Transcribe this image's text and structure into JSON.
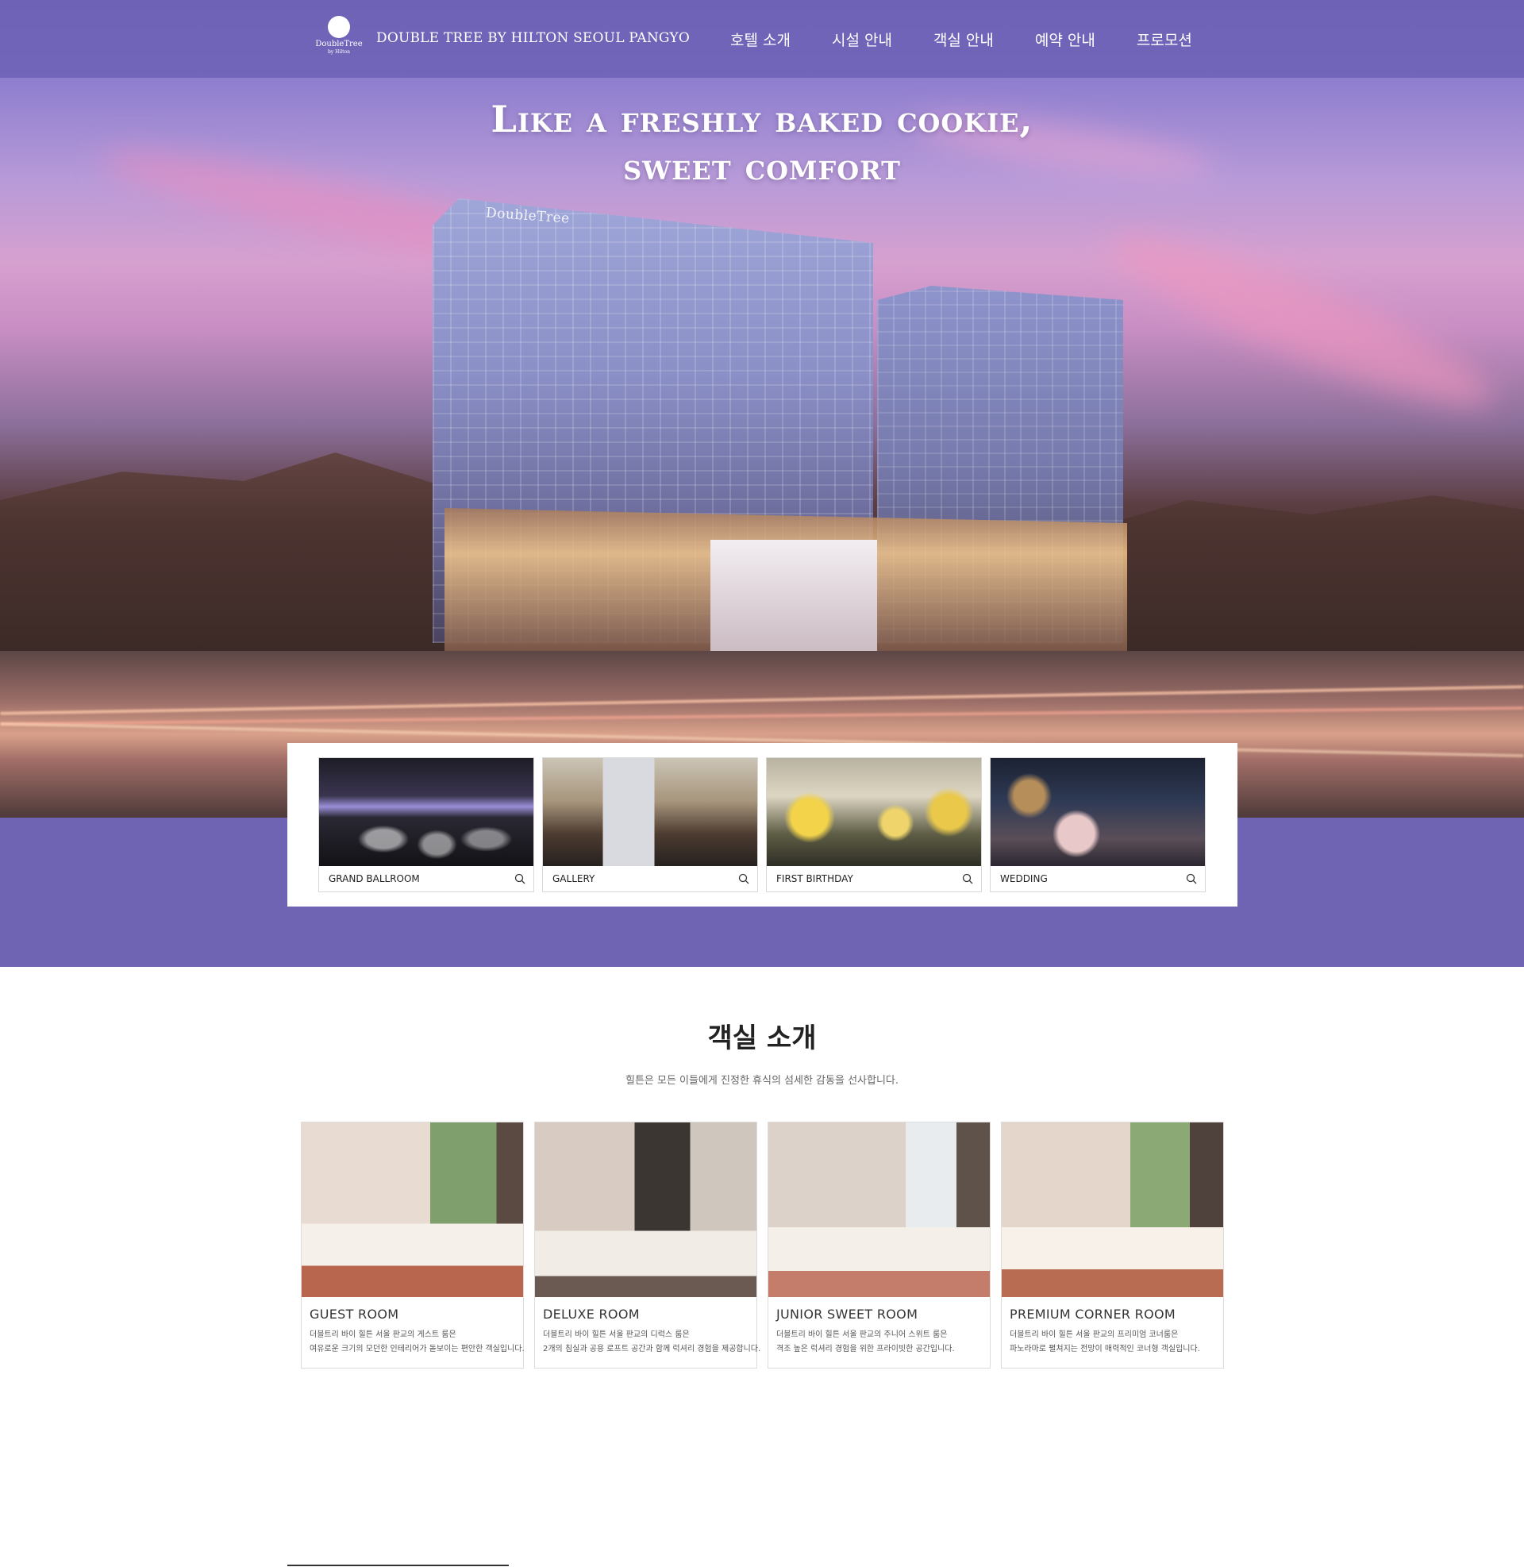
{
  "header": {
    "logo_text": "DoubleTree",
    "logo_sub": "by Hilton",
    "brand_title": "DOUBLE TREE BY HILTON SEOUL PANGYO",
    "nav": [
      "호텔 소개",
      "시설 안내",
      "객실 안내",
      "예약 안내",
      "프로모션"
    ]
  },
  "hero": {
    "title_line1": "Like a freshly baked cookie,",
    "title_line2": "sweet comfort",
    "building_sign": "DoubleTree"
  },
  "features": [
    {
      "label": "GRAND BALLROOM",
      "icon": "search-icon"
    },
    {
      "label": "GALLERY",
      "icon": "search-icon"
    },
    {
      "label": "FIRST BIRTHDAY",
      "icon": "search-icon"
    },
    {
      "label": "WEDDING",
      "icon": "search-icon"
    }
  ],
  "rooms_section": {
    "title": "객실 소개",
    "subtitle": "힐튼은 모든 이들에게 진정한 휴식의 섬세한 감동을 선사합니다.",
    "rooms": [
      {
        "name": "GUEST ROOM",
        "desc1": "더블트리 바이 힐튼 서울 판교의 게스트 룸은",
        "desc2": "여유로운 크기의 모던한 인테리어가 돋보이는 편안한 객실입니다."
      },
      {
        "name": "DELUXE ROOM",
        "desc1": "더블트리 바이 힐튼 서울 판교의 디럭스 룸은",
        "desc2": "2개의 침실과 공용 로프트 공간과 함께 럭셔리 경험을 제공합니다."
      },
      {
        "name": "JUNIOR SWEET ROOM",
        "desc1": "더블트리 바이 힐튼 서울 판교의 주니어 스위트 룸은",
        "desc2": "격조 높은 럭셔리 경험을 위한 프라이빗한 공간입니다."
      },
      {
        "name": "PREMIUM CORNER ROOM",
        "desc1": "더블트리 바이 힐튼 서울 판교의 프리미엄 코너룸은",
        "desc2": "파노라마로 펼쳐지는 전망이 매력적인 코너형 객실입니다."
      }
    ]
  },
  "colors": {
    "header_bg": "#695fb4",
    "band_purple": "#6f63b4",
    "white": "#ffffff"
  }
}
